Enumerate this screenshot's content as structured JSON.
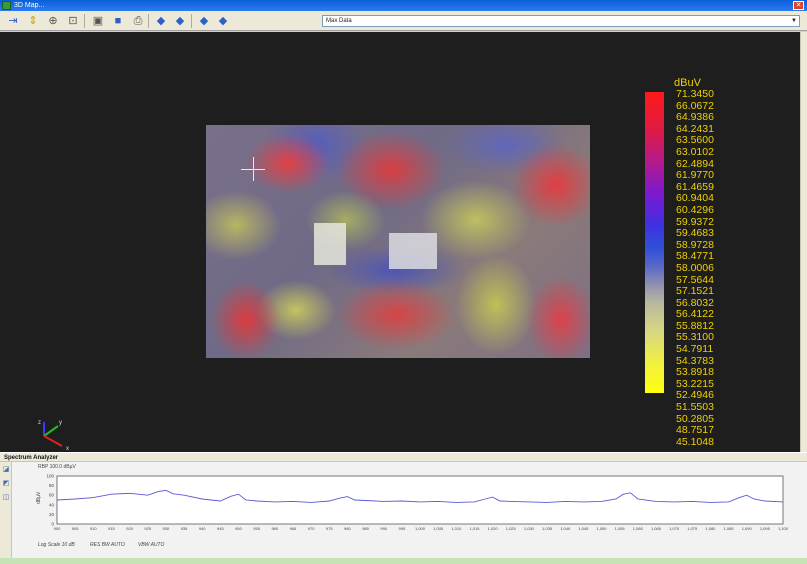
{
  "window": {
    "title": "3D Map..."
  },
  "toolbar": {
    "buttons": [
      {
        "name": "x-axis-icon",
        "glyph": "⇥"
      },
      {
        "name": "y-axis-icon",
        "glyph": "⇕"
      },
      {
        "name": "zoom-in-icon",
        "glyph": "⊕"
      },
      {
        "name": "zoom-fit-icon",
        "glyph": "⊡"
      },
      {
        "name": "export-image-icon",
        "glyph": "▣"
      },
      {
        "name": "save-icon",
        "glyph": "■"
      },
      {
        "name": "print-icon",
        "glyph": "⎙"
      },
      {
        "name": "rotate-left-icon",
        "glyph": "◆"
      },
      {
        "name": "rotate-right-icon",
        "glyph": "◆"
      },
      {
        "name": "view-top-icon",
        "glyph": "◆"
      },
      {
        "name": "view-side-icon",
        "glyph": "◆"
      }
    ],
    "combo_value": "Max Data"
  },
  "colorbar": {
    "unit": "dBuV",
    "labels": [
      "71.3450",
      "66.0672",
      "64.9386",
      "64.2431",
      "63.5600",
      "63.0102",
      "62.4894",
      "61.9770",
      "61.4659",
      "60.9404",
      "60.4296",
      "59.9372",
      "59.4683",
      "58.9728",
      "58.4771",
      "58.0006",
      "57.5644",
      "57.1521",
      "56.8032",
      "56.4122",
      "55.8812",
      "55.3100",
      "54.7911",
      "54.3783",
      "53.8918",
      "53.2215",
      "52.4946",
      "51.5503",
      "50.2805",
      "48.7517",
      "45.1048"
    ],
    "colors": {
      "top": "#ff1a1a",
      "middle": "#3050d8",
      "bottom": "#ffff10"
    }
  },
  "axes_indicator": {
    "x": "x",
    "y": "y",
    "z": "z"
  },
  "spectrum_panel": {
    "title": "Spectrum Analyzer",
    "rbw_text": "RBP 100.0 dBµV",
    "ylabel": "dBµV",
    "footer_left": "Log Scale 10 dB",
    "footer_mid": "RES BW AUTO",
    "footer_right": "VBW AUTO"
  },
  "chart_data": {
    "type": "line",
    "xlabel": "",
    "ylabel": "dBµV",
    "ylim": [
      0,
      100
    ],
    "yticks": [
      0,
      20,
      40,
      60,
      80,
      100
    ],
    "x_tick_labels": [
      "900",
      "905",
      "910",
      "915",
      "920",
      "925",
      "930",
      "935",
      "940",
      "945",
      "950",
      "955",
      "960",
      "965",
      "970",
      "975",
      "980",
      "985",
      "990",
      "995",
      "1,000",
      "1,005",
      "1,010",
      "1,015",
      "1,020",
      "1,025",
      "1,030",
      "1,035",
      "1,040",
      "1,045",
      "1,050",
      "1,055",
      "1,060",
      "1,065",
      "1,070",
      "1,075",
      "1,080",
      "1,085",
      "1,090",
      "1,095",
      "1,100"
    ],
    "x": [
      900,
      905,
      910,
      915,
      920,
      925,
      928,
      930,
      932,
      935,
      940,
      945,
      948,
      950,
      952,
      955,
      960,
      965,
      970,
      975,
      978,
      980,
      982,
      985,
      990,
      995,
      1000,
      1005,
      1010,
      1015,
      1018,
      1020,
      1022,
      1025,
      1030,
      1035,
      1040,
      1045,
      1050,
      1054,
      1056,
      1058,
      1060,
      1065,
      1070,
      1075,
      1080,
      1085,
      1088,
      1090,
      1092,
      1095,
      1100
    ],
    "y": [
      50,
      52,
      55,
      62,
      64,
      60,
      68,
      70,
      63,
      60,
      52,
      48,
      58,
      62,
      50,
      48,
      46,
      47,
      45,
      48,
      54,
      57,
      50,
      49,
      47,
      48,
      46,
      47,
      45,
      46,
      52,
      56,
      48,
      47,
      46,
      45,
      47,
      46,
      47,
      52,
      62,
      65,
      52,
      47,
      46,
      47,
      45,
      46,
      55,
      60,
      52,
      48,
      46
    ],
    "series_color": "#5a5ad8",
    "grid": false,
    "legend": "none"
  }
}
